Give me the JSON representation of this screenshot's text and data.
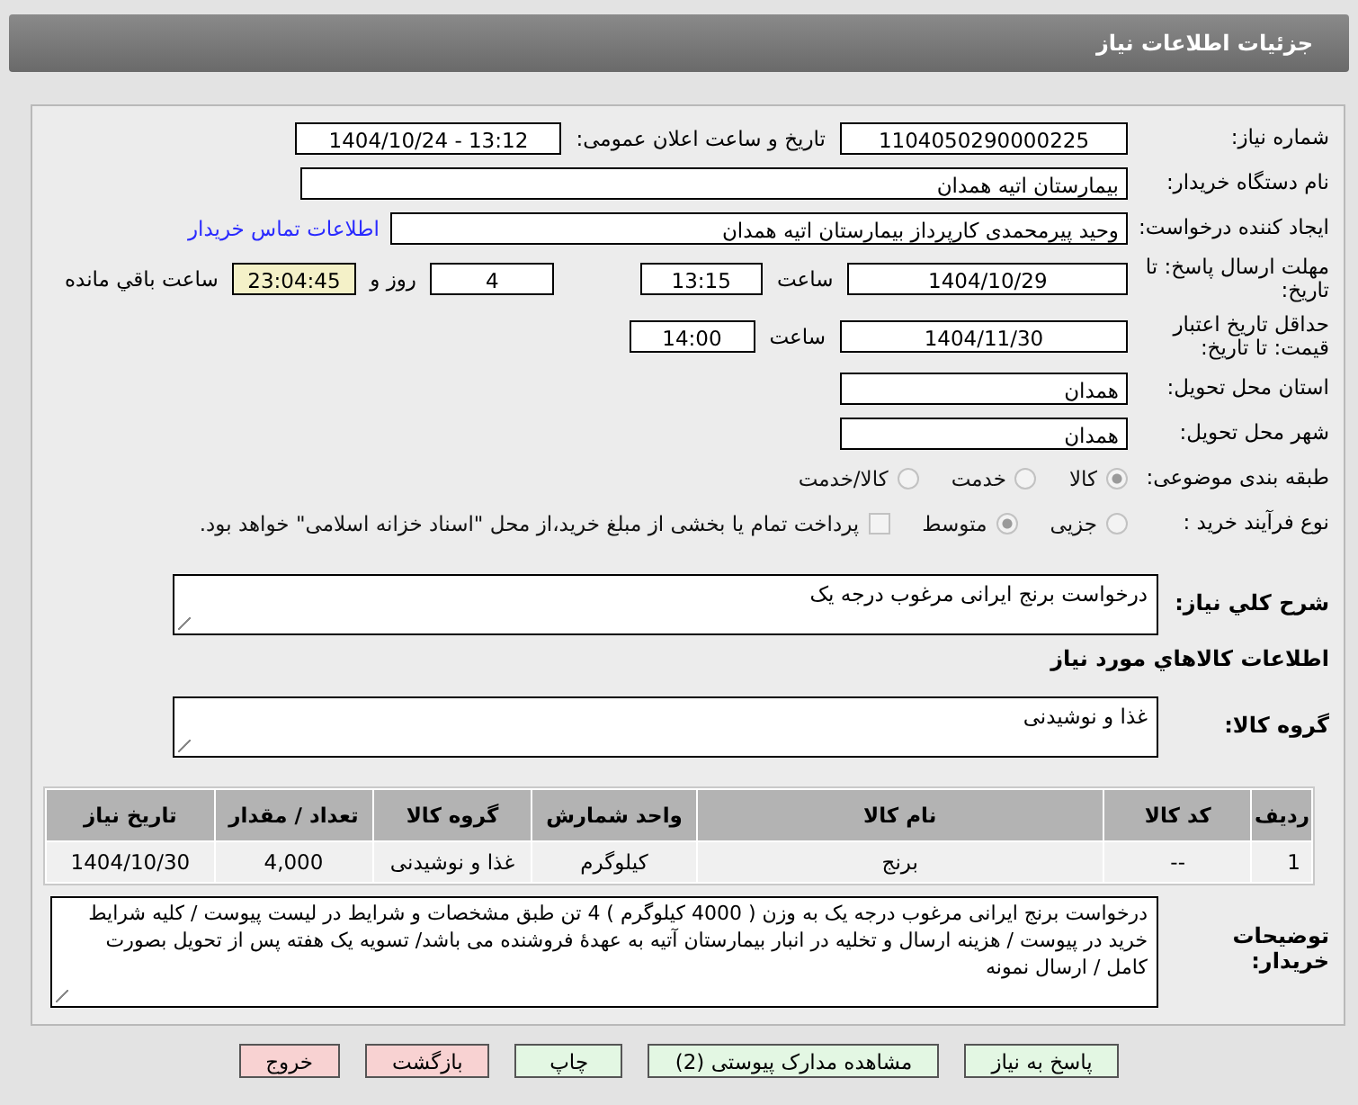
{
  "title": "جزئیات اطلاعات نیاز",
  "need_number": {
    "label": "شماره نیاز:",
    "value": "1104050290000225"
  },
  "announce": {
    "label": "تاریخ و ساعت اعلان عمومی:",
    "value": "1404/10/24 - 13:12"
  },
  "buyer_org": {
    "label": "نام دستگاه خریدار:",
    "value": "بیمارستان اتیه همدان"
  },
  "requester": {
    "label": "ایجاد کننده درخواست:",
    "value": "وحید پیرمحمدی کارپرداز بیمارستان اتیه همدان",
    "link": "اطلاعات تماس خریدار"
  },
  "deadline": {
    "label": "مهلت ارسال پاسخ: تا تاریخ:",
    "date": "1404/10/29",
    "time_label": "ساعت",
    "time": "13:15",
    "days": "4",
    "days_label": "روز و",
    "remaining": "23:04:45",
    "remaining_label": "ساعت باقي مانده"
  },
  "validity": {
    "label": "حداقل تاریخ اعتبار قیمت: تا تاریخ:",
    "date": "1404/11/30",
    "time_label": "ساعت",
    "time": "14:00"
  },
  "province": {
    "label": "استان محل تحویل:",
    "value": "همدان"
  },
  "city": {
    "label": "شهر محل تحویل:",
    "value": "همدان"
  },
  "category": {
    "label": "طبقه بندی موضوعی:",
    "options": [
      {
        "label": "کالا",
        "selected": true
      },
      {
        "label": "خدمت",
        "selected": false
      },
      {
        "label": "کالا/خدمت",
        "selected": false
      }
    ]
  },
  "process": {
    "label": "نوع فرآیند خرید :",
    "options": [
      {
        "label": "جزیی",
        "selected": false
      },
      {
        "label": "متوسط",
        "selected": true
      }
    ],
    "payment": {
      "label": "پرداخت تمام یا بخشی از مبلغ خرید،از محل \"اسناد خزانه اسلامی\" خواهد بود.",
      "checked": false
    }
  },
  "description": {
    "label": "شرح کلي نیاز:",
    "value": "درخواست برنج ایرانی مرغوب درجه یک"
  },
  "goods_heading": "اطلاعات کالاهاي مورد نیاز",
  "goods_group": {
    "label": "گروه کالا:",
    "value": "غذا و نوشیدنی"
  },
  "table": {
    "columns": [
      "ردیف",
      "کد کالا",
      "نام کالا",
      "واحد شمارش",
      "گروه کالا",
      "تعداد / مقدار",
      "تاریخ نیاز"
    ],
    "rows": [
      [
        "1",
        "--",
        "برنج",
        "کیلوگرم",
        "غذا و نوشیدنی",
        "4,000",
        "1404/10/30"
      ]
    ]
  },
  "buyer_notes": {
    "label": "توضیحات خریدار:",
    "value": "درخواست برنج ایرانی مرغوب درجه یک به وزن ( 4000 کیلوگرم ) 4 تن طبق مشخصات و شرایط در لیست پیوست / کلیه شرایط خرید در پیوست / هزینه ارسال و تخلیه در انبار بیمارستان آتیه به عهدهٔ فروشنده می باشد/ تسویه یک هفته پس از تحویل بصورت کامل / ارسال نمونه"
  },
  "buttons": [
    {
      "label": "پاسخ به نیاز",
      "kind": "normal"
    },
    {
      "label": "مشاهده مدارک پیوستی (2)",
      "kind": "normal"
    },
    {
      "label": "چاپ",
      "kind": "normal"
    },
    {
      "label": "بازگشت",
      "kind": "danger"
    },
    {
      "label": "خروج",
      "kind": "danger"
    }
  ]
}
